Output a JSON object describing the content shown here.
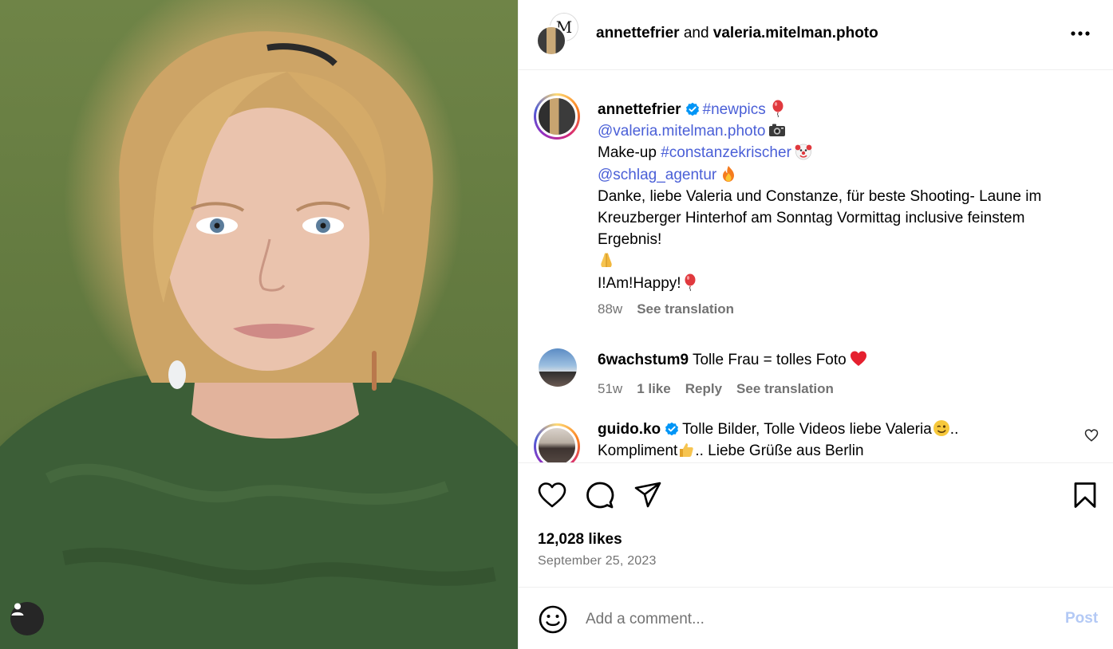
{
  "post": {
    "image_alt": "Portrait photo",
    "user_tag_icon": "person-icon"
  },
  "header": {
    "author": "annettefrier",
    "joiner": "and",
    "coauthor": "valeria.mitelman.photo",
    "coauthor_avatar_letter": "M",
    "more_icon": "more-horizontal-icon"
  },
  "caption": {
    "username": "annettefrier",
    "verified": true,
    "hashtag1": "#newpics",
    "mention1": "@valeria.mitelman.photo",
    "makeup_prefix": "Make-up",
    "hashtag2": "#constanzekrischer",
    "mention2": "@schlag_agentur",
    "line_danke": "Danke, liebe Valeria und Constanze, für beste Shooting- Laune im",
    "line_kreuz": "Kreuzberger Hinterhof am Sonntag Vormittag inclusive feinstem",
    "line_ergebnis": "Ergebnis!",
    "line_happy": "I!Am!Happy!",
    "time": "88w",
    "see_translation": "See translation"
  },
  "comments": [
    {
      "username": "6wachstum9",
      "text": "Tolle Frau = tolles Foto",
      "time": "51w",
      "likes": "1 like",
      "reply": "Reply",
      "see_translation": "See translation"
    },
    {
      "username": "guido.ko",
      "verified": true,
      "text": "Tolle Bilder, Tolle Videos liebe Valeria",
      "text_after_emoji": "..",
      "text_line2": "Kompliment",
      "text_line2_rest": ".. Liebe Grüße aus Berlin"
    }
  ],
  "actions": {
    "like_icon": "heart-icon",
    "comment_icon": "comment-icon",
    "share_icon": "share-icon",
    "save_icon": "bookmark-icon",
    "likes": "12,028 likes",
    "date": "September 25, 2023"
  },
  "composer": {
    "emoji_icon": "smiley-icon",
    "placeholder": "Add a comment...",
    "post_label": "Post"
  },
  "colors": {
    "link": "#4a5fd7",
    "verified": "#0095f6",
    "muted": "#737373",
    "post_disabled": "#b3c9f5"
  }
}
